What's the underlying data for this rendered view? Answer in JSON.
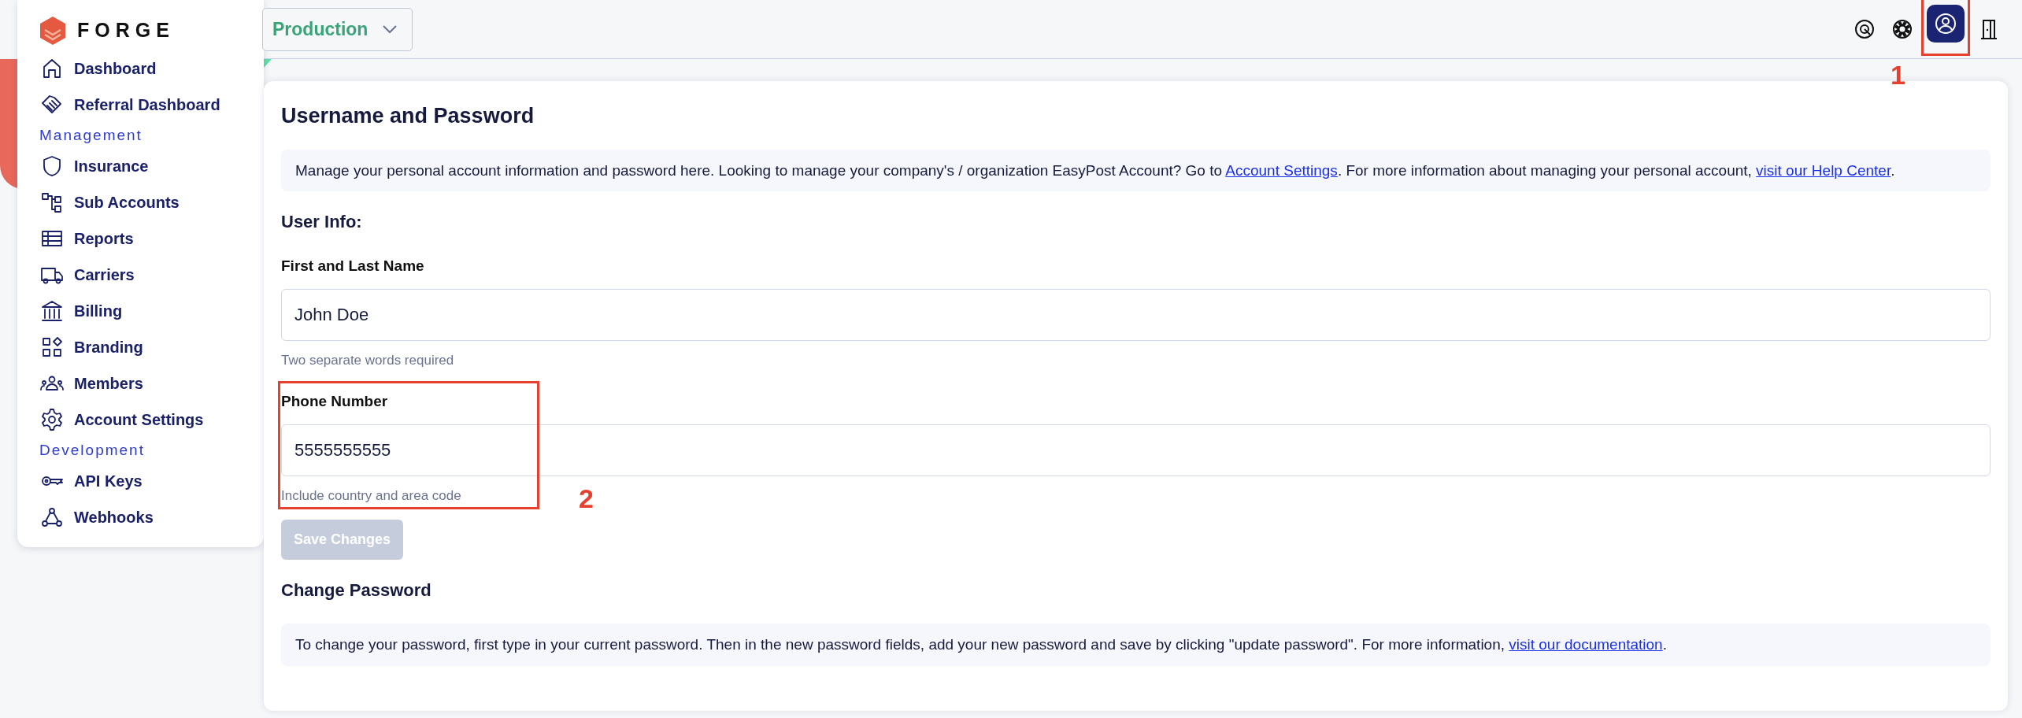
{
  "brand": {
    "name": "FORGE"
  },
  "sidebar": {
    "items": [
      {
        "kind": "link",
        "label": "Dashboard"
      },
      {
        "kind": "link",
        "label": "Referral Dashboard"
      },
      {
        "kind": "heading",
        "label": "Management"
      },
      {
        "kind": "link",
        "label": "Insurance"
      },
      {
        "kind": "link",
        "label": "Sub Accounts"
      },
      {
        "kind": "link",
        "label": "Reports"
      },
      {
        "kind": "link",
        "label": "Carriers"
      },
      {
        "kind": "link",
        "label": "Billing"
      },
      {
        "kind": "link",
        "label": "Branding"
      },
      {
        "kind": "link",
        "label": "Members"
      },
      {
        "kind": "link",
        "label": "Account Settings"
      },
      {
        "kind": "heading",
        "label": "Development"
      },
      {
        "kind": "link",
        "label": "API Keys"
      },
      {
        "kind": "link",
        "label": "Webhooks"
      }
    ]
  },
  "topbar": {
    "environment": "Production",
    "actions": [
      {
        "kind": "mentions",
        "selected": false
      },
      {
        "kind": "help",
        "selected": false
      },
      {
        "kind": "profile",
        "selected": true,
        "callout": "1"
      },
      {
        "kind": "logout",
        "selected": false
      }
    ]
  },
  "card": {
    "title": "Username and Password",
    "intro": [
      {
        "text": "Manage your personal account information and password here. Looking to manage your company's / organization EasyPost Account? Go to "
      },
      {
        "text": "Account Settings",
        "link": true
      },
      {
        "text": ". For more information about managing your personal account, "
      },
      {
        "text": "visit our Help Center",
        "link": true
      },
      {
        "text": "."
      }
    ],
    "section_title": "User Info:",
    "fields": [
      {
        "label": "First and Last Name",
        "value": "John Doe",
        "help": "Two separate words required"
      },
      {
        "label": "Phone Number",
        "value": "5555555555",
        "help": "Include country and area code",
        "callout": "2"
      }
    ],
    "save_button": {
      "label": "Save Changes",
      "disabled": true
    },
    "password_title": "Change Password",
    "password_note": [
      {
        "text": "To change your password, first type in your current password. Then in the new password fields, add your new password and save by clicking \"update password\". For more information, "
      },
      {
        "text": "visit our documentation",
        "link": true
      },
      {
        "text": "."
      }
    ]
  }
}
